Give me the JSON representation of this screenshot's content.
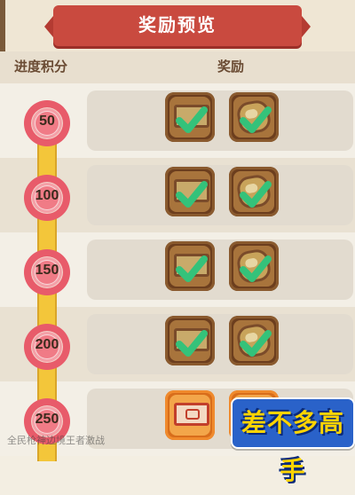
{
  "banner": {
    "title": "奖励预览"
  },
  "header": {
    "left": "进度积分",
    "right": "奖励"
  },
  "rows": [
    {
      "score": "50"
    },
    {
      "score": "100"
    },
    {
      "score": "150"
    },
    {
      "score": "200"
    },
    {
      "score": "250"
    }
  ],
  "colors": {
    "banner": "#c94a3f",
    "flower": "#e85b6a",
    "progress_bar": "#f3c63a",
    "check": "#34c27a",
    "item_brown": "#6c3e1e",
    "item_orange": "#d86d1b"
  },
  "logo": {
    "text": "差不多高手"
  },
  "watermark": {
    "text": "全民枪神边境王者激战"
  }
}
